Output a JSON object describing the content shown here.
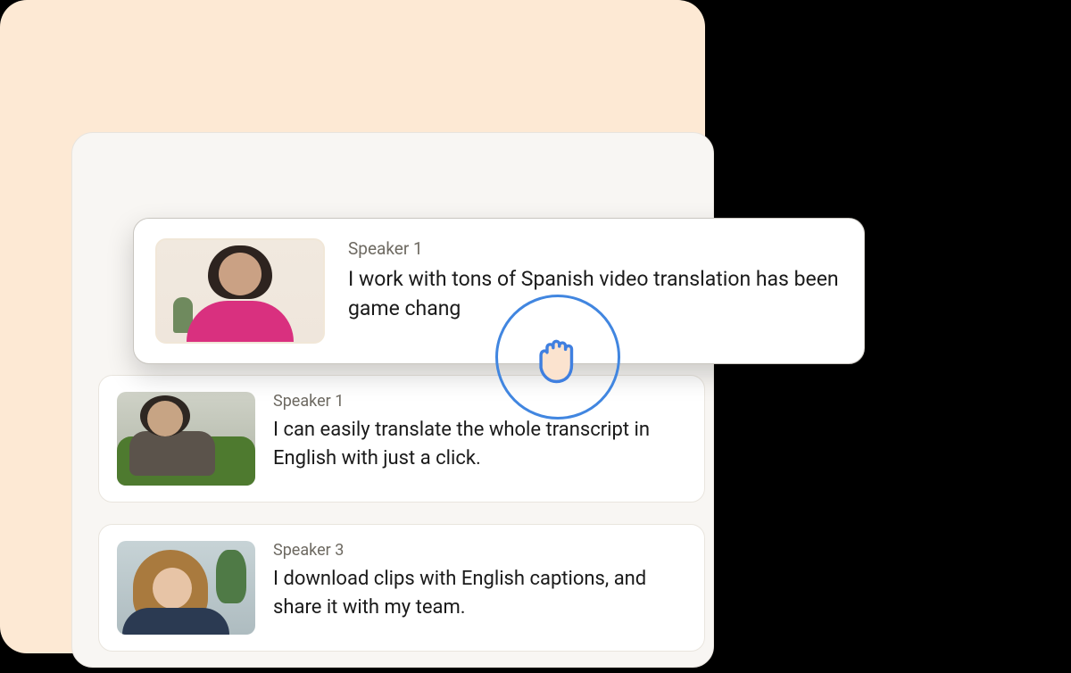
{
  "cards": {
    "floating": {
      "speaker": "Speaker 1",
      "quote": "I work with tons of Spanish video translation has been game chang"
    },
    "second": {
      "speaker": "Speaker 1",
      "quote": "I can easily translate the whole transcript in English with just a click."
    },
    "third": {
      "speaker": "Speaker 3",
      "quote": "I download clips with English captions, and share it with my team."
    }
  },
  "cursor": {
    "type": "grab-hand"
  },
  "colors": {
    "backdrop": "#fde9d4",
    "panel": "#f8f6f3",
    "accent": "#4186e0"
  }
}
